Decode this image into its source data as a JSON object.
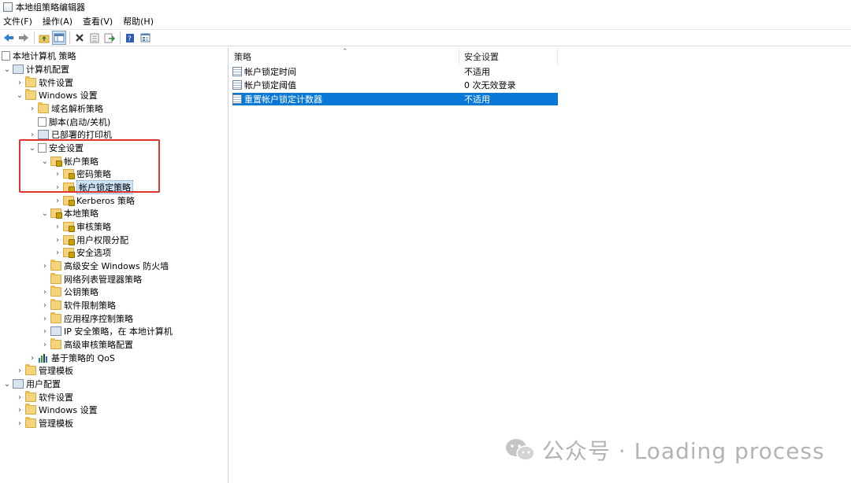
{
  "window": {
    "title": "本地组策略编辑器"
  },
  "menu": [
    "文件(F)",
    "操作(A)",
    "查看(V)",
    "帮助(H)"
  ],
  "toolbar": {
    "icons": [
      "back-icon",
      "forward-icon",
      "up-folder-icon",
      "show-tree-icon",
      "delete-icon",
      "properties-icon",
      "export-icon",
      "help-icon",
      "view-icon"
    ]
  },
  "tree": {
    "root": "本地计算机 策略",
    "computer_config": "计算机配置",
    "software_settings": "软件设置",
    "windows_settings": "Windows 设置",
    "dns_policy": "域名解析策略",
    "scripts": "脚本(启动/关机)",
    "printers": "已部署的打印机",
    "security_settings": "安全设置",
    "account_policies": "帐户策略",
    "password_policy": "密码策略",
    "lockout_policy": "帐户锁定策略",
    "kerberos_policy": "Kerberos 策略",
    "local_policies": "本地策略",
    "audit_policy": "审核策略",
    "user_rights": "用户权限分配",
    "security_options": "安全选项",
    "firewall": "高级安全 Windows 防火墙",
    "network_list": "网络列表管理器策略",
    "public_key": "公钥策略",
    "software_restriction": "软件限制策略",
    "app_control": "应用程序控制策略",
    "ip_security": "IP 安全策略，在 本地计算机",
    "advanced_audit": "高级审核策略配置",
    "qos": "基于策略的 QoS",
    "admin_templates": "管理模板",
    "user_config": "用户配置",
    "user_software_settings": "软件设置",
    "user_windows_settings": "Windows 设置",
    "user_admin_templates": "管理模板"
  },
  "list": {
    "columns": [
      "策略",
      "安全设置"
    ],
    "rows": [
      {
        "policy": "帐户锁定时间",
        "setting": "不适用"
      },
      {
        "policy": "帐户锁定阈值",
        "setting": "0 次无效登录"
      },
      {
        "policy": "重置帐户锁定计数器",
        "setting": "不适用"
      }
    ]
  },
  "watermark": {
    "text": "公众号 · Loading process"
  },
  "colors": {
    "selection": "#0a78d7",
    "header": "#dbeaf7",
    "highlight_box": "#e0352e"
  }
}
